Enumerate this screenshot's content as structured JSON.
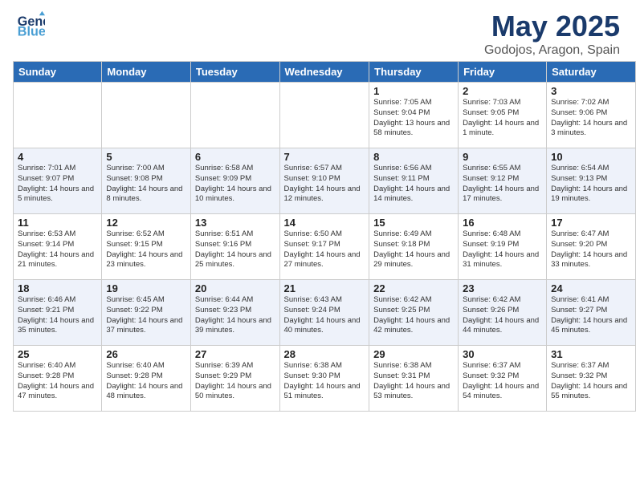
{
  "header": {
    "logo_general": "General",
    "logo_blue": "Blue",
    "title": "May 2025",
    "subtitle": "Godojos, Aragon, Spain"
  },
  "weekdays": [
    "Sunday",
    "Monday",
    "Tuesday",
    "Wednesday",
    "Thursday",
    "Friday",
    "Saturday"
  ],
  "weeks": [
    {
      "days": [
        {
          "num": "",
          "info": ""
        },
        {
          "num": "",
          "info": ""
        },
        {
          "num": "",
          "info": ""
        },
        {
          "num": "",
          "info": ""
        },
        {
          "num": "1",
          "info": "Sunrise: 7:05 AM\nSunset: 9:04 PM\nDaylight: 13 hours\nand 58 minutes."
        },
        {
          "num": "2",
          "info": "Sunrise: 7:03 AM\nSunset: 9:05 PM\nDaylight: 14 hours\nand 1 minute."
        },
        {
          "num": "3",
          "info": "Sunrise: 7:02 AM\nSunset: 9:06 PM\nDaylight: 14 hours\nand 3 minutes."
        }
      ]
    },
    {
      "days": [
        {
          "num": "4",
          "info": "Sunrise: 7:01 AM\nSunset: 9:07 PM\nDaylight: 14 hours\nand 5 minutes."
        },
        {
          "num": "5",
          "info": "Sunrise: 7:00 AM\nSunset: 9:08 PM\nDaylight: 14 hours\nand 8 minutes."
        },
        {
          "num": "6",
          "info": "Sunrise: 6:58 AM\nSunset: 9:09 PM\nDaylight: 14 hours\nand 10 minutes."
        },
        {
          "num": "7",
          "info": "Sunrise: 6:57 AM\nSunset: 9:10 PM\nDaylight: 14 hours\nand 12 minutes."
        },
        {
          "num": "8",
          "info": "Sunrise: 6:56 AM\nSunset: 9:11 PM\nDaylight: 14 hours\nand 14 minutes."
        },
        {
          "num": "9",
          "info": "Sunrise: 6:55 AM\nSunset: 9:12 PM\nDaylight: 14 hours\nand 17 minutes."
        },
        {
          "num": "10",
          "info": "Sunrise: 6:54 AM\nSunset: 9:13 PM\nDaylight: 14 hours\nand 19 minutes."
        }
      ]
    },
    {
      "days": [
        {
          "num": "11",
          "info": "Sunrise: 6:53 AM\nSunset: 9:14 PM\nDaylight: 14 hours\nand 21 minutes."
        },
        {
          "num": "12",
          "info": "Sunrise: 6:52 AM\nSunset: 9:15 PM\nDaylight: 14 hours\nand 23 minutes."
        },
        {
          "num": "13",
          "info": "Sunrise: 6:51 AM\nSunset: 9:16 PM\nDaylight: 14 hours\nand 25 minutes."
        },
        {
          "num": "14",
          "info": "Sunrise: 6:50 AM\nSunset: 9:17 PM\nDaylight: 14 hours\nand 27 minutes."
        },
        {
          "num": "15",
          "info": "Sunrise: 6:49 AM\nSunset: 9:18 PM\nDaylight: 14 hours\nand 29 minutes."
        },
        {
          "num": "16",
          "info": "Sunrise: 6:48 AM\nSunset: 9:19 PM\nDaylight: 14 hours\nand 31 minutes."
        },
        {
          "num": "17",
          "info": "Sunrise: 6:47 AM\nSunset: 9:20 PM\nDaylight: 14 hours\nand 33 minutes."
        }
      ]
    },
    {
      "days": [
        {
          "num": "18",
          "info": "Sunrise: 6:46 AM\nSunset: 9:21 PM\nDaylight: 14 hours\nand 35 minutes."
        },
        {
          "num": "19",
          "info": "Sunrise: 6:45 AM\nSunset: 9:22 PM\nDaylight: 14 hours\nand 37 minutes."
        },
        {
          "num": "20",
          "info": "Sunrise: 6:44 AM\nSunset: 9:23 PM\nDaylight: 14 hours\nand 39 minutes."
        },
        {
          "num": "21",
          "info": "Sunrise: 6:43 AM\nSunset: 9:24 PM\nDaylight: 14 hours\nand 40 minutes."
        },
        {
          "num": "22",
          "info": "Sunrise: 6:42 AM\nSunset: 9:25 PM\nDaylight: 14 hours\nand 42 minutes."
        },
        {
          "num": "23",
          "info": "Sunrise: 6:42 AM\nSunset: 9:26 PM\nDaylight: 14 hours\nand 44 minutes."
        },
        {
          "num": "24",
          "info": "Sunrise: 6:41 AM\nSunset: 9:27 PM\nDaylight: 14 hours\nand 45 minutes."
        }
      ]
    },
    {
      "days": [
        {
          "num": "25",
          "info": "Sunrise: 6:40 AM\nSunset: 9:28 PM\nDaylight: 14 hours\nand 47 minutes."
        },
        {
          "num": "26",
          "info": "Sunrise: 6:40 AM\nSunset: 9:28 PM\nDaylight: 14 hours\nand 48 minutes."
        },
        {
          "num": "27",
          "info": "Sunrise: 6:39 AM\nSunset: 9:29 PM\nDaylight: 14 hours\nand 50 minutes."
        },
        {
          "num": "28",
          "info": "Sunrise: 6:38 AM\nSunset: 9:30 PM\nDaylight: 14 hours\nand 51 minutes."
        },
        {
          "num": "29",
          "info": "Sunrise: 6:38 AM\nSunset: 9:31 PM\nDaylight: 14 hours\nand 53 minutes."
        },
        {
          "num": "30",
          "info": "Sunrise: 6:37 AM\nSunset: 9:32 PM\nDaylight: 14 hours\nand 54 minutes."
        },
        {
          "num": "31",
          "info": "Sunrise: 6:37 AM\nSunset: 9:32 PM\nDaylight: 14 hours\nand 55 minutes."
        }
      ]
    }
  ]
}
